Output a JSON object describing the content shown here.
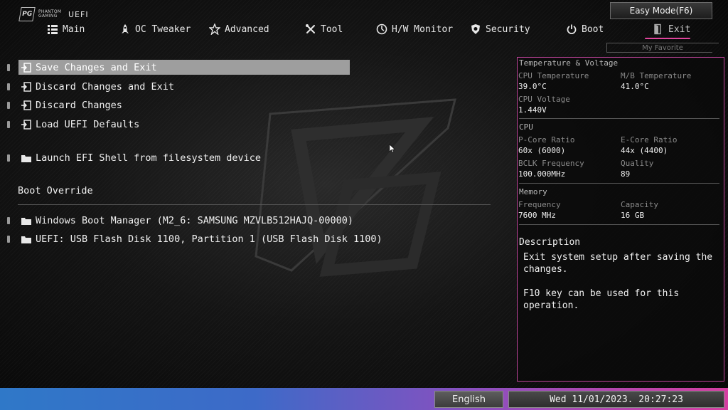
{
  "brand": {
    "line1": "PHANTOM",
    "line2": "GAMING",
    "uefi": "UEFI"
  },
  "header": {
    "easy_mode": "Easy Mode(F6)",
    "my_favorite": "My Favorite"
  },
  "nav": {
    "items": [
      {
        "label": "Main",
        "icon": "list-icon"
      },
      {
        "label": "OC Tweaker",
        "icon": "rocket-icon"
      },
      {
        "label": "Advanced",
        "icon": "star-icon"
      },
      {
        "label": "Tool",
        "icon": "tools-icon"
      },
      {
        "label": "H/W Monitor",
        "icon": "monitor-icon"
      },
      {
        "label": "Security",
        "icon": "shield-icon"
      },
      {
        "label": "Boot",
        "icon": "power-icon"
      },
      {
        "label": "Exit",
        "icon": "exit-icon"
      }
    ],
    "active": "Exit"
  },
  "menu": {
    "items": [
      {
        "label": "Save Changes and Exit",
        "selected": true
      },
      {
        "label": "Discard Changes and Exit"
      },
      {
        "label": "Discard Changes"
      },
      {
        "label": "Load UEFI Defaults"
      },
      {
        "label": "Launch EFI Shell from filesystem device"
      }
    ],
    "boot_override_title": "Boot Override",
    "boot_items": [
      {
        "label": "Windows Boot Manager (M2_6: SAMSUNG MZVLB512HAJQ-00000)"
      },
      {
        "label": "UEFI: USB Flash Disk 1100, Partition 1 (USB Flash Disk 1100)"
      }
    ]
  },
  "panel": {
    "temp_voltage": {
      "title": "Temperature & Voltage",
      "cpu_temp_label": "CPU Temperature",
      "cpu_temp": "39.0°C",
      "mb_temp_label": "M/B Temperature",
      "mb_temp": "41.0°C",
      "cpu_voltage_label": "CPU Voltage",
      "cpu_voltage": "1.440V"
    },
    "cpu": {
      "title": "CPU",
      "pcore_label": "P-Core Ratio",
      "pcore": "60x (6000)",
      "ecore_label": "E-Core Ratio",
      "ecore": "44x (4400)",
      "bclk_label": "BCLK Frequency",
      "bclk": "100.000MHz",
      "quality_label": "Quality",
      "quality": "89"
    },
    "memory": {
      "title": "Memory",
      "freq_label": "Frequency",
      "freq": "7600 MHz",
      "cap_label": "Capacity",
      "cap": "16 GB"
    },
    "description": {
      "title": "Description",
      "text": "Exit system setup after saving the changes.\n\nF10 key can be used for this operation."
    }
  },
  "footer": {
    "language": "English",
    "datetime": "Wed 11/01/2023. 20:27:23"
  },
  "colors": {
    "accent": "#e0449c",
    "panel_border": "#c0449b",
    "highlight": "#9e9e9e"
  }
}
